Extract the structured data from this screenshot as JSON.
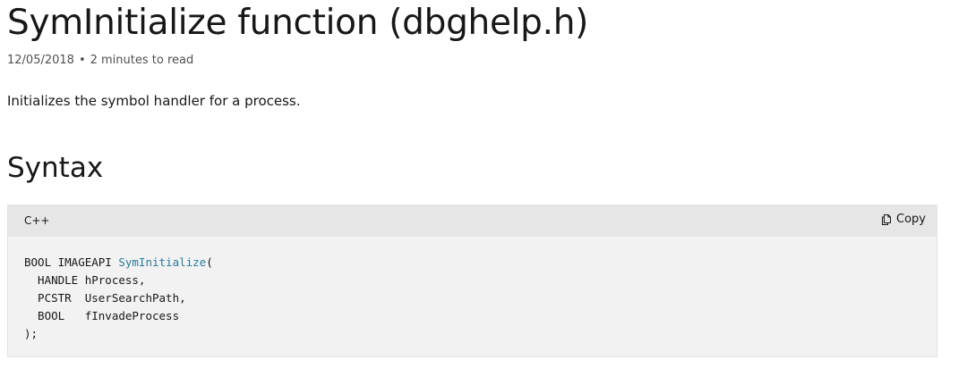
{
  "header": {
    "title": "SymInitialize function (dbghelp.h)",
    "date": "12/05/2018",
    "separator": "•",
    "read_time": "2 minutes to read"
  },
  "summary": "Initializes the symbol handler for a process.",
  "syntax": {
    "heading": "Syntax",
    "code_block": {
      "language": "C++",
      "copy_label": "Copy",
      "copy_icon": "copy-icon",
      "accent_color": "#2b7b9a",
      "line1_prefix": "BOOL IMAGEAPI ",
      "function_name": "SymInitialize",
      "line1_suffix": "(",
      "line2": "  HANDLE hProcess,",
      "line3": "  PCSTR  UserSearchPath,",
      "line4": "  BOOL   fInvadeProcess",
      "line5": ");"
    }
  }
}
